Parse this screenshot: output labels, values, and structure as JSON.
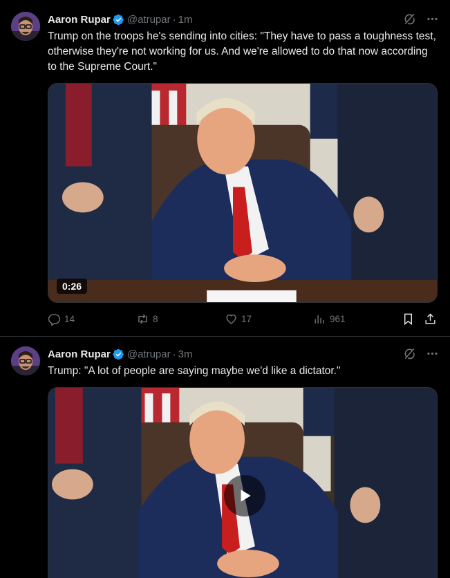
{
  "tweets": [
    {
      "author_name": "Aaron Rupar",
      "handle": "@atrupar",
      "separator": "·",
      "time": "1m",
      "text": "Trump on the troops he's sending into cities: \"They have to pass a toughness test, otherwise they're not working for us. And we're allowed to do that now according to the Supreme Court.\"",
      "media": {
        "duration": "0:26"
      },
      "stats": {
        "replies": "14",
        "reposts": "8",
        "likes": "17",
        "views": "961"
      }
    },
    {
      "author_name": "Aaron Rupar",
      "handle": "@atrupar",
      "separator": "·",
      "time": "3m",
      "text": "Trump: \"A lot of people are saying maybe we'd like a dictator.\""
    }
  ],
  "icons": [
    "verified-badge-icon",
    "grok-icon",
    "more-icon",
    "reply-icon",
    "repost-icon",
    "like-icon",
    "views-icon",
    "bookmark-icon",
    "share-icon",
    "play-icon"
  ],
  "colors": {
    "background": "#000000",
    "text": "#e7e9ea",
    "secondary": "#71767b",
    "verified": "#1d9bf0",
    "divider": "#2f3336"
  }
}
